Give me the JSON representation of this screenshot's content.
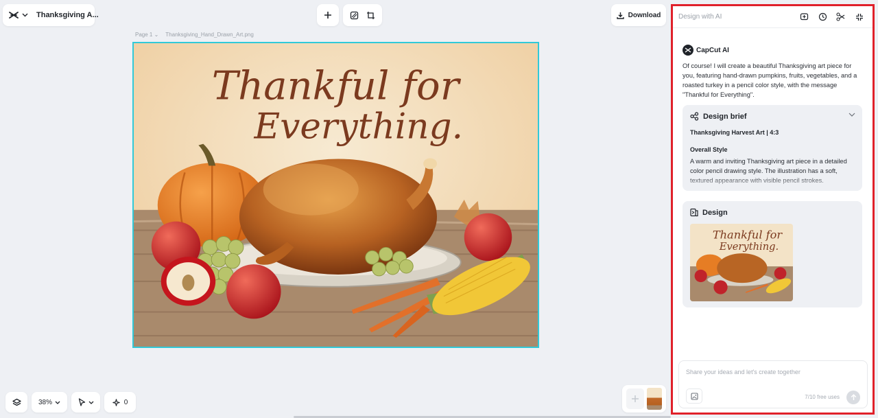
{
  "app": {
    "project_title": "Thanksgiving A..."
  },
  "toolbar": {
    "download_label": "Download"
  },
  "page": {
    "page_label": "Page 1",
    "file_name": "Thanksgiving_Hand_Drawn_Art.png"
  },
  "canvas": {
    "headline_line1": "Thankful for",
    "headline_line2": "Everything."
  },
  "bottom": {
    "zoom": "38%",
    "spark_count": "0"
  },
  "panel": {
    "title": "Design with AI",
    "assistant_name": "CapCut AI",
    "message": "Of course! I will create a beautiful Thanksgiving art piece for you, featuring hand-drawn pumpkins, fruits, vegetables, and a roasted turkey in a pencil color style, with the message \"Thankful for Everything\".",
    "brief": {
      "heading": "Design brief",
      "subtitle": "Thanksgiving Harvest Art | 4:3",
      "section": "Overall Style",
      "text": "A warm and inviting Thanksgiving art piece in a detailed color pencil drawing style. The illustration has a soft, textured appearance with visible pencil strokes."
    },
    "design": {
      "heading": "Design"
    },
    "input": {
      "placeholder": "Share your ideas and let's create together",
      "uses": "7/10 free uses"
    }
  },
  "colors": {
    "accent": "#31c9d8",
    "highlight_border": "#e0202a"
  }
}
